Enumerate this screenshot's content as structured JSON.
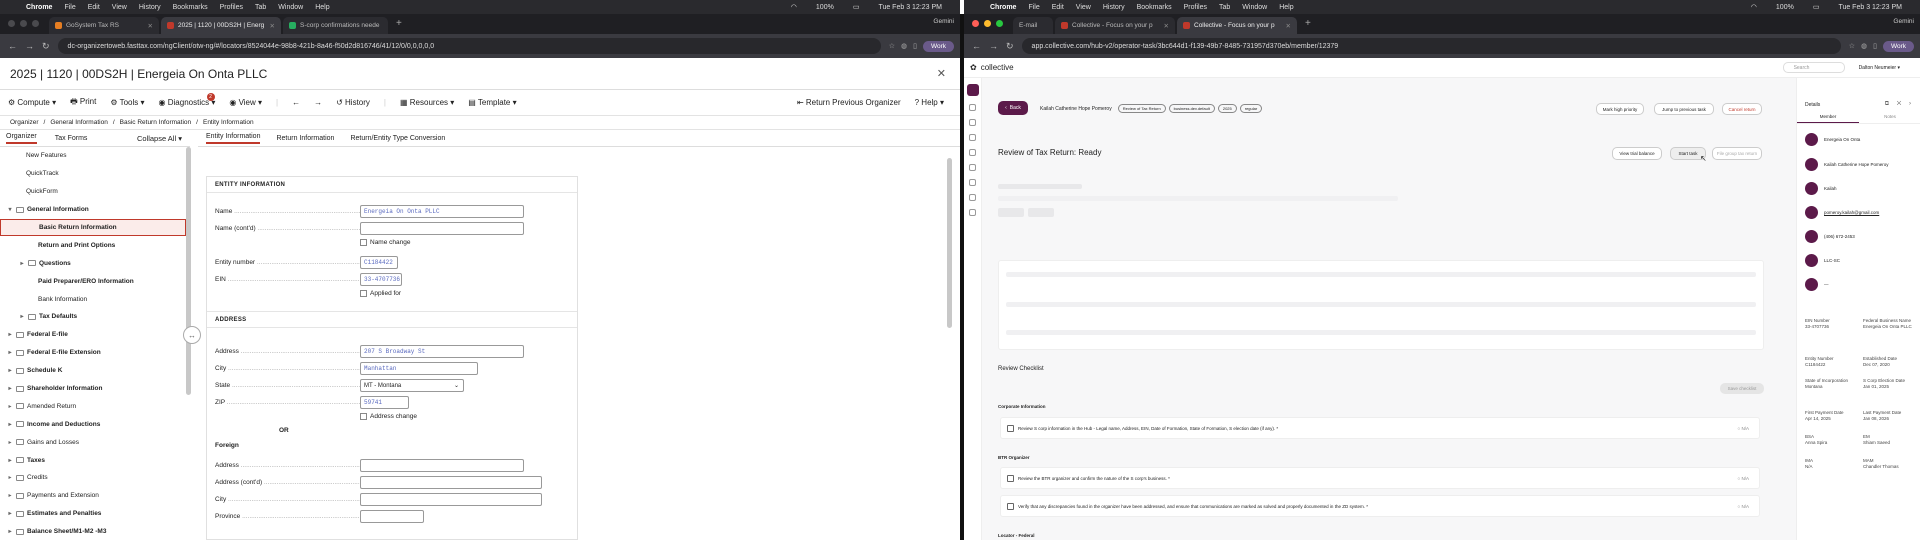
{
  "menubar_left": {
    "app": "Chrome",
    "items": [
      "File",
      "Edit",
      "View",
      "History",
      "Bookmarks",
      "Profiles",
      "Tab",
      "Window",
      "Help"
    ],
    "battery": "100%",
    "time": "Tue Feb 3  12:23 PM"
  },
  "menubar_right": {
    "app": "Chrome",
    "items": [
      "File",
      "Edit",
      "View",
      "History",
      "Bookmarks",
      "Profiles",
      "Tab",
      "Window",
      "Help"
    ],
    "battery": "100%",
    "time": "Tue Feb 3  12:23 PM"
  },
  "browser_left": {
    "tabs": [
      "GoSystem Tax RS",
      "2025 | 1120 | 00DS2H | Energ",
      "S-corp confirmations neede"
    ],
    "gemini": "Gemini",
    "url": "dc-organizertoweb.fasttax.com/ngClient/otw-ng/#/locators/8524044e-98b8-421b-8a46-f50d2d816746/41/12/0/0,0,0,0,0",
    "profile": "Work"
  },
  "browser_right": {
    "tabs": [
      "E-mail",
      "Collective - Focus on your p",
      "Collective - Focus on your p"
    ],
    "gemini": "Gemini",
    "url": "app.collective.com/hub-v2/operator-task/3bc644d1-f139-49b7-8485-731957d370eb/member/12379",
    "profile": "Work"
  },
  "ft": {
    "title": "2025 | 1120 | 00DS2H | Energeia On Onta PLLC",
    "toolbar": [
      "Compute",
      "Print",
      "Tools",
      "Diagnostics",
      "View",
      "History",
      "Resources",
      "Template"
    ],
    "diag_badge": "2",
    "return_prev": "Return Previous Organizer",
    "help": "Help",
    "breadcrumb": [
      "Organizer",
      "General Information",
      "Basic Return Information",
      "Entity Information"
    ],
    "left_tabs": [
      "Organizer",
      "Tax Forms"
    ],
    "collapse": "Collapse All",
    "tree": [
      {
        "label": "New Features",
        "indent": 1
      },
      {
        "label": "QuickTrack",
        "indent": 1
      },
      {
        "label": "QuickForm",
        "indent": 1
      },
      {
        "label": "General Information",
        "indent": 0,
        "caret": "open",
        "folder": true,
        "bold": true
      },
      {
        "label": "Basic Return Information",
        "indent": 2,
        "bold": true,
        "selected": true
      },
      {
        "label": "Return and Print Options",
        "indent": 2,
        "bold": true
      },
      {
        "label": "Questions",
        "indent": 1,
        "caret": "closed",
        "folder": true,
        "bold": true
      },
      {
        "label": "Paid Preparer/ERO Information",
        "indent": 2,
        "bold": true
      },
      {
        "label": "Bank Information",
        "indent": 2
      },
      {
        "label": "Tax Defaults",
        "indent": 1,
        "caret": "closed",
        "folder": true,
        "bold": true
      },
      {
        "label": "Federal E-file",
        "indent": 0,
        "caret": "closed",
        "folder": true,
        "bold": true
      },
      {
        "label": "Federal E-file Extension",
        "indent": 0,
        "caret": "closed",
        "folder": true,
        "bold": true
      },
      {
        "label": "Schedule K",
        "indent": 0,
        "caret": "closed",
        "folder": true,
        "bold": true
      },
      {
        "label": "Shareholder Information",
        "indent": 0,
        "caret": "closed",
        "folder": true,
        "bold": true
      },
      {
        "label": "Amended Return",
        "indent": 0,
        "caret": "closed",
        "folder": true
      },
      {
        "label": "Income and Deductions",
        "indent": 0,
        "caret": "closed",
        "folder": true,
        "bold": true
      },
      {
        "label": "Gains and Losses",
        "indent": 0,
        "caret": "closed",
        "folder": true
      },
      {
        "label": "Taxes",
        "indent": 0,
        "caret": "closed",
        "folder": true,
        "bold": true
      },
      {
        "label": "Credits",
        "indent": 0,
        "caret": "closed",
        "folder": true
      },
      {
        "label": "Payments and Extension",
        "indent": 0,
        "caret": "closed",
        "folder": true
      },
      {
        "label": "Estimates and Penalties",
        "indent": 0,
        "caret": "closed",
        "folder": true,
        "bold": true
      },
      {
        "label": "Balance Sheet/M1-M2 -M3",
        "indent": 0,
        "caret": "closed",
        "folder": true,
        "bold": true
      }
    ],
    "main_tabs": [
      "Entity Information",
      "Return Information",
      "Return/Entity Type Conversion"
    ],
    "entity_head": "ENTITY INFORMATION",
    "address_head": "ADDRESS",
    "labels": {
      "name": "Name",
      "name2": "Name (cont'd)",
      "name_change": "Name change",
      "entity_no": "Entity number",
      "ein": "EIN",
      "applied": "Applied for",
      "address": "Address",
      "city": "City",
      "state": "State",
      "zip": "ZIP",
      "addr_change": "Address change",
      "or": "OR",
      "foreign": "Foreign",
      "f_address": "Address",
      "f_address2": "Address (cont'd)",
      "f_city": "City",
      "f_province": "Province"
    },
    "values": {
      "name": "Energeia On Onta PLLC",
      "entity_no": "C1184422",
      "ein": "33-4707736",
      "address": "207 S Broadway St",
      "city": "Manhattan",
      "state": "MT - Montana",
      "zip": "59741"
    }
  },
  "cv": {
    "logo": "collective",
    "search": "Search",
    "user": "Dalton Neumeier",
    "back": "Back",
    "person": "Kailah Catherine Hope Pomeroy",
    "pills": [
      "Review of Tax Return",
      "business.dev.default",
      "2025",
      "regular"
    ],
    "btns": [
      "Mark high priority",
      "Jump to previous task",
      "Cancel return"
    ],
    "heading": "Review of Tax Return: Ready",
    "hbtns": [
      "View trial balance",
      "Start task",
      "File group tax return"
    ],
    "checklist": "Review Checklist",
    "save": "Save checklist",
    "sections": [
      "Corporate Information",
      "BTR Organizer",
      "Locator - Federal"
    ],
    "items": [
      "Review S corp information in the Hub - Legal name, Address, EIN, Date of Formation, State of Formation, S election date (if any). *",
      "Review the BTR organizer and confirm the nature of the S corp's business. *",
      "Verify that any discrepancies found in the organizer have been addressed, and ensure that communications are marked as solved and properly documented in the ZD system. *"
    ],
    "na": "N/A",
    "details": {
      "title": "Details",
      "tabs": [
        "Member",
        "Notes"
      ],
      "rows": [
        "Energeia On Onta",
        "Kailah Catherine Hope Pomeroy",
        "Kailah",
        "pomeroy.kailah@gmail.com",
        "(406) 672-2453",
        "LLC-SC",
        "—"
      ],
      "kv": [
        [
          "EIN Number",
          "33-4707736"
        ],
        [
          "Federal Business Name",
          "Energeia On Onta PLLC"
        ],
        [
          "Entity Number",
          "C1184422"
        ],
        [
          "Established Date",
          "Dec 07, 2020"
        ],
        [
          "State of Incorporation",
          "Montana"
        ],
        [
          "S Corp Election Date",
          "Jan 01, 2025"
        ],
        [
          "First Payment Date",
          "Apr 14, 2025"
        ],
        [
          "Last Payment Date",
          "Jan 08, 2026"
        ],
        [
          "BSA",
          "Anna Spira"
        ],
        [
          "EM",
          "Shiam Saeed"
        ],
        [
          "IMA",
          "N/A"
        ],
        [
          "MAM",
          "Chandler Thomas"
        ]
      ]
    }
  },
  "colors": {
    "accent": "#c0392b",
    "brand": "#5c1a4a"
  }
}
